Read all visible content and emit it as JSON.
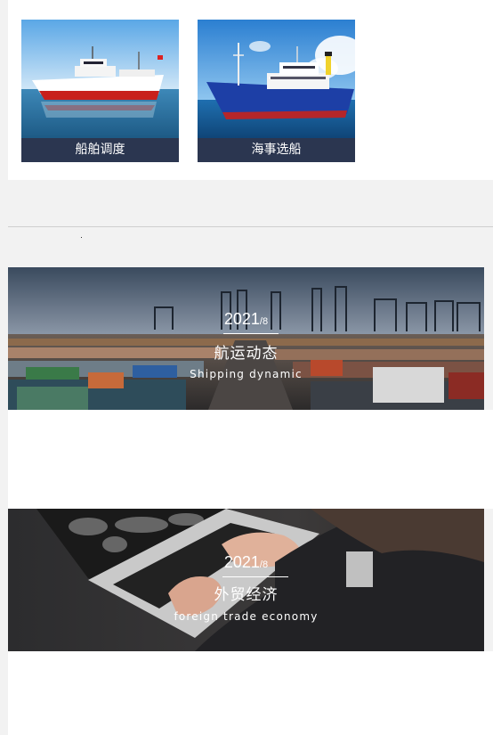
{
  "ships": [
    {
      "caption": "船舶调度"
    },
    {
      "caption": "海事选船"
    }
  ],
  "banners": [
    {
      "year": "2021",
      "month": "/8",
      "title_cn": "航运动态",
      "title_en": "Shipping dynamic"
    },
    {
      "year": "2021",
      "month": "/8",
      "title_cn": "外贸经济",
      "title_en": "foreign trade economy"
    }
  ]
}
